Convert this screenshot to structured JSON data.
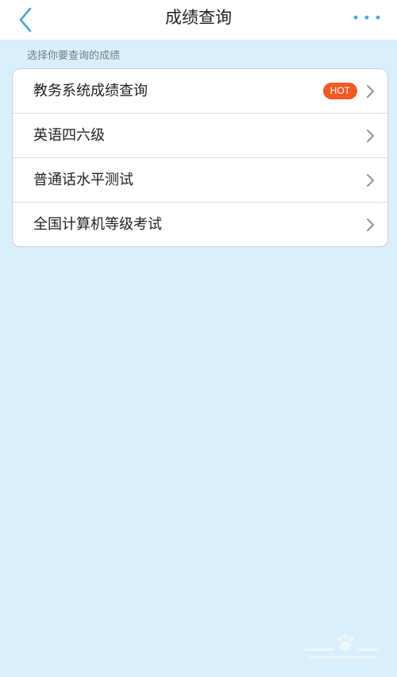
{
  "navbar": {
    "title": "成绩查询",
    "back_icon": "chevron-left-icon",
    "more_icon": "more-dots-icon"
  },
  "section": {
    "header": "选择你要查询的成绩"
  },
  "list": [
    {
      "label": "教务系统成绩查询",
      "badge": "HOT"
    },
    {
      "label": "英语四六级"
    },
    {
      "label": "普通话水平测试"
    },
    {
      "label": "全国计算机等级考试"
    }
  ],
  "colors": {
    "accent": "#3fa8e6",
    "background": "#d9f0fc",
    "hot_badge": "#f15a22"
  }
}
